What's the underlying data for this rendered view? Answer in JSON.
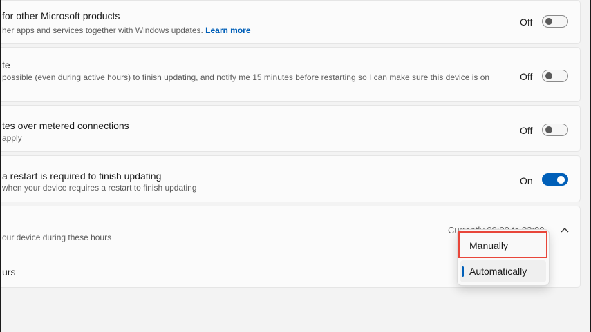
{
  "rows": [
    {
      "title": "for other Microsoft products",
      "description": "her apps and services together with Windows updates.",
      "link": "Learn more",
      "state": "Off"
    },
    {
      "title": "te",
      "description": "possible (even during active hours) to finish updating, and notify me 15 minutes before restarting so I can make sure this device is on",
      "state": "Off"
    },
    {
      "title": "tes over metered connections",
      "description": "apply",
      "state": "Off"
    },
    {
      "title": "a restart is required to finish updating",
      "description": "when your device requires a restart to finish updating",
      "state": "On"
    }
  ],
  "active_hours": {
    "description": "our device during these hours",
    "current": "Currently 09:00 to 02:00",
    "sub_label": "urs"
  },
  "dropdown": {
    "options": [
      "Manually",
      "Automatically"
    ],
    "selected": "Automatically",
    "highlighted": "Manually"
  },
  "colors": {
    "accent": "#005fb8",
    "highlight": "#e8463a"
  },
  "icons": {
    "expand": "chevron-up-icon"
  }
}
